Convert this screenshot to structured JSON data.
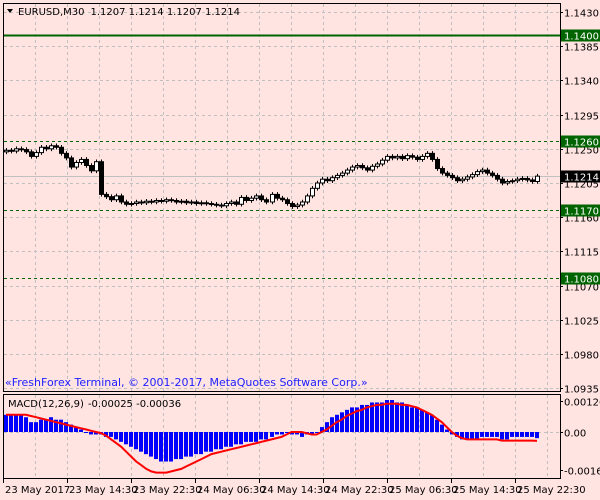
{
  "header": {
    "symbol": "EURUSD,M30",
    "ohlc": "1.1207 1.1214 1.1207 1.1214",
    "menu_icon": "triangle-down-icon"
  },
  "copyright": "«FreshForex Terminal, © 2001-2017, MetaQuotes Software Corp.»",
  "colors": {
    "background": "#FFE4E1",
    "grid": "#C0C0C0",
    "level": "#006400",
    "histogram": "#0000FF",
    "signal": "#FF0000",
    "bear": "#000000",
    "bull": "#FFFFFF"
  },
  "chart_data": [
    {
      "type": "candlestick",
      "title": "EURUSD,M30",
      "price_ticks": [
        "1.1430",
        "1.1385",
        "1.1340",
        "1.1295",
        "1.1250",
        "1.1205",
        "1.1160",
        "1.1115",
        "1.1070",
        "1.1025",
        "1.0980",
        "1.0935"
      ],
      "ylim": [
        1.0935,
        1.143
      ],
      "levels": [
        {
          "label": "1.1400",
          "value": 1.14,
          "style": "solid"
        },
        {
          "label": "1.1260",
          "value": 1.126,
          "style": "dashed"
        },
        {
          "label": "1.1170",
          "value": 1.117,
          "style": "dashed"
        },
        {
          "label": "1.1080",
          "value": 1.108,
          "style": "dashed"
        }
      ],
      "current_price": {
        "label": "1.1214",
        "value": 1.1214
      },
      "first_open": 1.1246,
      "closes": [
        1.1248,
        1.1247,
        1.125,
        1.1249,
        1.1246,
        1.124,
        1.1245,
        1.1252,
        1.125,
        1.1254,
        1.1252,
        1.1244,
        1.1238,
        1.1226,
        1.1232,
        1.1236,
        1.1228,
        1.1221,
        1.1233,
        1.119,
        1.1187,
        1.1183,
        1.1188,
        1.118,
        1.1177,
        1.1178,
        1.118,
        1.1179,
        1.1181,
        1.118,
        1.1182,
        1.1181,
        1.1183,
        1.1182,
        1.118,
        1.1181,
        1.1179,
        1.118,
        1.1178,
        1.1179,
        1.1178,
        1.1177,
        1.1176,
        1.1175,
        1.1178,
        1.118,
        1.1177,
        1.1186,
        1.1182,
        1.1185,
        1.1188,
        1.1183,
        1.118,
        1.119,
        1.1185,
        1.1183,
        1.1178,
        1.1174,
        1.1176,
        1.118,
        1.1188,
        1.1198,
        1.1205,
        1.121,
        1.1208,
        1.1212,
        1.1215,
        1.1218,
        1.1222,
        1.1226,
        1.1228,
        1.1225,
        1.1222,
        1.1227,
        1.123,
        1.1235,
        1.124,
        1.1238,
        1.124,
        1.1237,
        1.1241,
        1.1239,
        1.1236,
        1.124,
        1.1244,
        1.1236,
        1.1224,
        1.1218,
        1.1215,
        1.1212,
        1.1208,
        1.121,
        1.1213,
        1.1216,
        1.122,
        1.1222,
        1.1218,
        1.1215,
        1.121,
        1.1205,
        1.1207,
        1.1208,
        1.121,
        1.1211,
        1.1209,
        1.1207,
        1.1214
      ],
      "time_labels": [
        "23 May 2017",
        "23 May 14:30",
        "23 May 22:30",
        "24 May 06:30",
        "24 May 14:30",
        "24 May 22:30",
        "25 May 06:30",
        "25 May 14:30",
        "25 May 22:30"
      ]
    },
    {
      "type": "bar+line",
      "title": "MACD(12,26,9)",
      "values_label": "-0.00025 -0.00036",
      "ticks": [
        "0.00126",
        "0.00",
        "-0.00163"
      ],
      "ylim": [
        -0.00163,
        0.00126
      ],
      "unit": 0.0001,
      "histogram": [
        7,
        7,
        7,
        7,
        6,
        4,
        4,
        5,
        5,
        6,
        5,
        5,
        4,
        3,
        2,
        1,
        0,
        -1,
        -1,
        -1,
        -2,
        -2,
        -3,
        -4,
        -5,
        -6,
        -7,
        -8,
        -9,
        -10,
        -11,
        -12,
        -12,
        -12,
        -11,
        -11,
        -10,
        -10,
        -9,
        -9,
        -8,
        -8,
        -7,
        -7,
        -6,
        -6,
        -5,
        -5,
        -4,
        -4,
        -4,
        -3,
        -3,
        -2,
        -1,
        -1,
        0,
        -1,
        -1,
        -2,
        -1,
        -1,
        0,
        2,
        4,
        6,
        7,
        8,
        9,
        10,
        10,
        11,
        11,
        12,
        12,
        12,
        13,
        13,
        12,
        12,
        11,
        10,
        10,
        9,
        8,
        7,
        5,
        3,
        1,
        -1,
        -2,
        -3,
        -3,
        -3,
        -3,
        -2,
        -2,
        -2,
        -2,
        -3,
        -3,
        -2,
        -2,
        -2,
        -2,
        -2,
        -2.5
      ],
      "signal": [
        7,
        7,
        7,
        7,
        7,
        6.5,
        6,
        5.5,
        5,
        4.5,
        4,
        3.5,
        3,
        2.5,
        2,
        1.5,
        1,
        0.5,
        0,
        -0.5,
        -1.5,
        -3,
        -4.5,
        -6,
        -8,
        -10,
        -12,
        -13.5,
        -15,
        -16,
        -16.5,
        -16.5,
        -16.5,
        -16,
        -15.5,
        -15,
        -14,
        -13,
        -12,
        -11,
        -10,
        -9,
        -8.5,
        -8,
        -7.5,
        -7,
        -6.5,
        -6,
        -5.5,
        -5,
        -4.5,
        -4,
        -3.5,
        -3,
        -2.5,
        -2,
        -1,
        0,
        0,
        0,
        -0.5,
        -1,
        -1,
        0,
        1,
        2.5,
        4,
        5,
        6.5,
        7.5,
        8.5,
        9,
        10,
        10.5,
        11,
        11,
        11.5,
        11.5,
        11.5,
        11,
        11,
        10.5,
        10,
        9,
        8,
        7,
        5.5,
        4,
        2,
        0,
        -1.5,
        -2.5,
        -3,
        -3,
        -3,
        -3,
        -3,
        -3,
        -3,
        -3.5,
        -3.5,
        -3.5,
        -3.5,
        -3.5,
        -3.5,
        -3.5,
        -3.6
      ]
    }
  ]
}
